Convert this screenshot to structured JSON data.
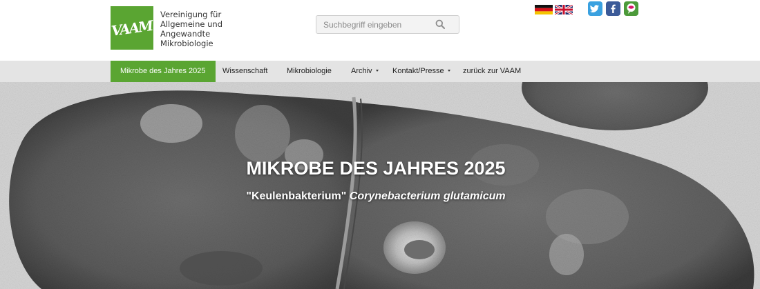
{
  "header": {
    "logo_text": "VAAM",
    "org_lines": [
      "Vereinigung für",
      "Allgemeine und",
      "Angewandte",
      "Mikrobiologie"
    ],
    "search_placeholder": "Suchbegriff eingeben",
    "icons": [
      "search-icon",
      "german-flag-icon",
      "english-flag-icon",
      "twitter-icon",
      "facebook-icon",
      "mikrobe-icon"
    ]
  },
  "nav": {
    "items": [
      {
        "label": "Mikrobe des Jahres 2025",
        "active": true
      },
      {
        "label": "Wissenschaft"
      },
      {
        "label": "Mikrobiologie"
      },
      {
        "label": "Archiv",
        "dropdown": true
      },
      {
        "label": "Kontakt/Presse",
        "dropdown": true
      },
      {
        "label": "zurück zur VAAM"
      }
    ]
  },
  "hero": {
    "title": "MIKROBE DES JAHRES 2025",
    "subtitle_common": "\"Keulenbakterium\"",
    "subtitle_latin": "Corynebacterium glutamicum"
  },
  "colors": {
    "brand_green": "#5aa532",
    "nav_bg": "#e4e4e4",
    "twitter": "#3aa1e0",
    "facebook": "#3b5a98"
  }
}
